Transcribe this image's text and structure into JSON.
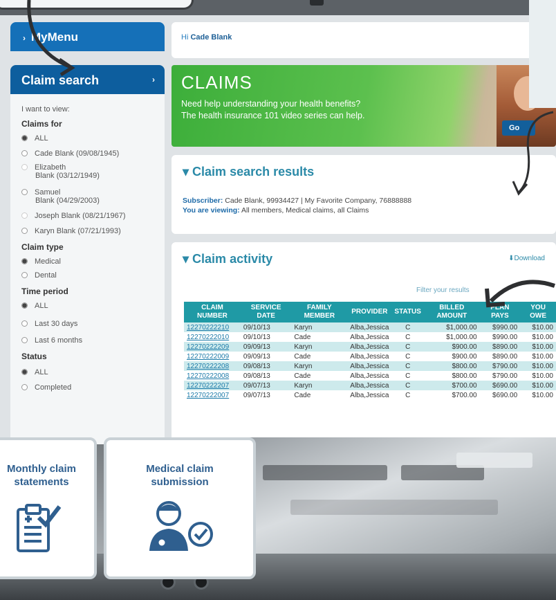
{
  "sidebar": {
    "mymenu_label": "MyMenu",
    "claim_search_label": "Claim search",
    "want_to_view": "I want to view:",
    "claims_for_heading": "Claims for",
    "claims_for_options": [
      {
        "label": "ALL",
        "selected": true
      },
      {
        "label": "Cade Blank (09/08/1945)"
      },
      {
        "label": "Elizabeth",
        "label2": "Blank (03/12/1949)",
        "dim": true
      },
      {
        "label": "Samuel",
        "label2": "Blank (04/29/2003)"
      },
      {
        "label": "Joseph Blank (08/21/1967)",
        "dim": true
      },
      {
        "label": "Karyn Blank (07/21/1993)"
      }
    ],
    "claim_type_heading": "Claim type",
    "claim_type_options": [
      {
        "label": "Medical",
        "selected": true
      },
      {
        "label": "Dental"
      }
    ],
    "time_period_heading": "Time period",
    "time_period_options": [
      {
        "label": "ALL",
        "selected": true
      },
      {
        "label": "Last 30 days"
      },
      {
        "label": "Last 6 months"
      }
    ],
    "status_heading": "Status",
    "status_options": [
      {
        "label": "ALL",
        "selected": true
      },
      {
        "label": "Completed"
      }
    ]
  },
  "greeting": {
    "prefix": "Hi",
    "name": "Cade Blank"
  },
  "banner": {
    "title": "CLAIMS",
    "line1": "Need help understanding your health benefits?",
    "line2": "The health insurance 101 video series can help.",
    "go_label": "Go"
  },
  "results": {
    "heading": "Claim search results",
    "subscriber_label": "Subscriber:",
    "subscriber_value": "Cade Blank, 99934427 | My Favorite Company, 76888888",
    "viewing_label": "You are viewing:",
    "viewing_value": "All members, Medical claims, all Claims"
  },
  "activity": {
    "heading": "Claim activity",
    "download_label": "Download",
    "filter_label": "Filter your results",
    "columns": [
      "CLAIM NUMBER",
      "SERVICE DATE",
      "FAMILY MEMBER",
      "PROVIDER",
      "STATUS",
      "BILLED AMOUNT",
      "PLAN PAYS",
      "YOU OWE"
    ],
    "rows": [
      [
        "12270222210",
        "09/10/13",
        "Karyn",
        "Alba,Jessica",
        "C",
        "$1,000.00",
        "$990.00",
        "$10.00"
      ],
      [
        "12270222010",
        "09/10/13",
        "Cade",
        "Alba,Jessica",
        "C",
        "$1,000.00",
        "$990.00",
        "$10.00"
      ],
      [
        "12270222209",
        "09/09/13",
        "Karyn",
        "Alba,Jessica",
        "C",
        "$900.00",
        "$890.00",
        "$10.00"
      ],
      [
        "12270222009",
        "09/09/13",
        "Cade",
        "Alba,Jessica",
        "C",
        "$900.00",
        "$890.00",
        "$10.00"
      ],
      [
        "12270222208",
        "09/08/13",
        "Karyn",
        "Alba,Jessica",
        "C",
        "$800.00",
        "$790.00",
        "$10.00"
      ],
      [
        "12270222008",
        "09/08/13",
        "Cade",
        "Alba,Jessica",
        "C",
        "$800.00",
        "$790.00",
        "$10.00"
      ],
      [
        "12270222207",
        "09/07/13",
        "Karyn",
        "Alba,Jessica",
        "C",
        "$700.00",
        "$690.00",
        "$10.00"
      ],
      [
        "12270222007",
        "09/07/13",
        "Cade",
        "Alba,Jessica",
        "C",
        "$700.00",
        "$690.00",
        "$10.00"
      ]
    ]
  },
  "tiles": [
    {
      "line1": "Monthly claim",
      "line2": "statements",
      "icon": "checklist-icon"
    },
    {
      "line1": "Medical claim",
      "line2": "submission",
      "icon": "doctor-check-icon"
    }
  ],
  "colors": {
    "brand_blue": "#1570b8",
    "teal": "#1f9aa5",
    "green": "#3cae3a"
  }
}
